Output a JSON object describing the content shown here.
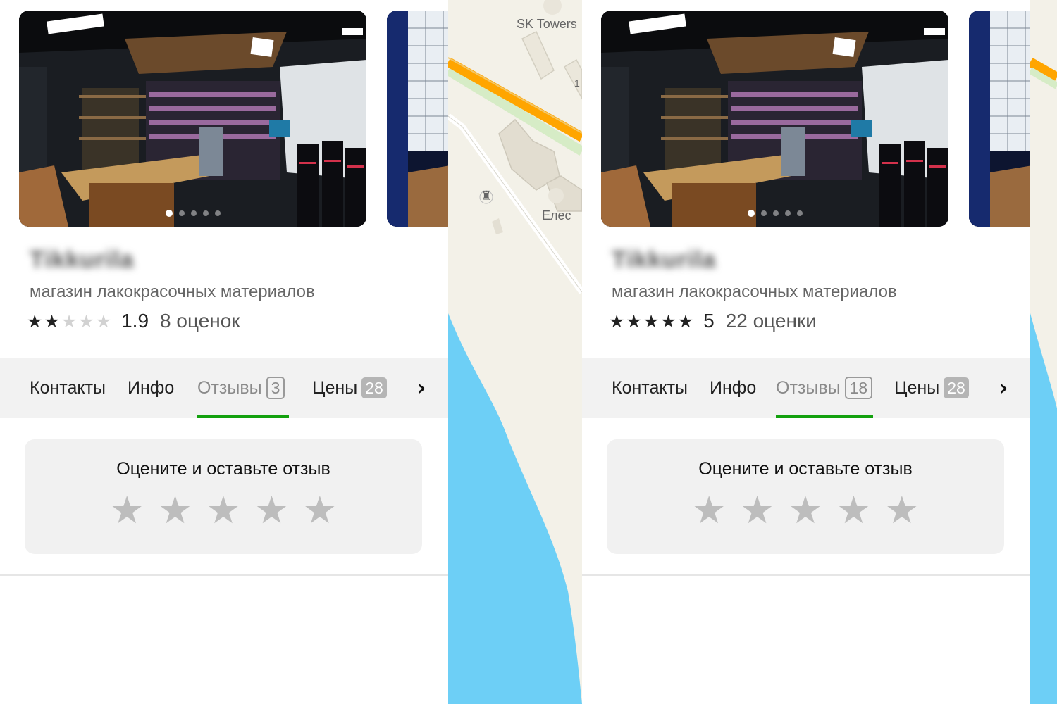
{
  "cards": [
    {
      "name": "Tikkurila",
      "category": "магазин лакокрасочных материалов",
      "rating_value": "1.9",
      "rating_count": "8 оценок",
      "stars_filled": 2,
      "tabs": {
        "contacts": "Контакты",
        "info": "Инфо",
        "reviews": "Отзывы",
        "reviews_count": "3",
        "prices": "Цены",
        "prices_count": "28"
      },
      "review_prompt": "Оцените и оставьте отзыв"
    },
    {
      "name": "Tikkurila",
      "category": "магазин лакокрасочных материалов",
      "rating_value": "5",
      "rating_count": "22 оценки",
      "stars_filled": 5,
      "tabs": {
        "contacts": "Контакты",
        "info": "Инфо",
        "reviews": "Отзывы",
        "reviews_count": "18",
        "prices": "Цены",
        "prices_count": "28"
      },
      "review_prompt": "Оцените и оставьте отзыв"
    }
  ],
  "photo_carousel": {
    "total": 5,
    "active": 1
  },
  "map": {
    "labels": {
      "tower": "SK Towers",
      "building": "Елес",
      "number": "1"
    }
  },
  "colors": {
    "active_tab_underline": "#13a10e",
    "star_filled": "#222222",
    "star_empty": "#d2d2d2",
    "rate_star": "#bdbdbd",
    "water": "#6dcff6",
    "road_major": "#ffa500"
  }
}
